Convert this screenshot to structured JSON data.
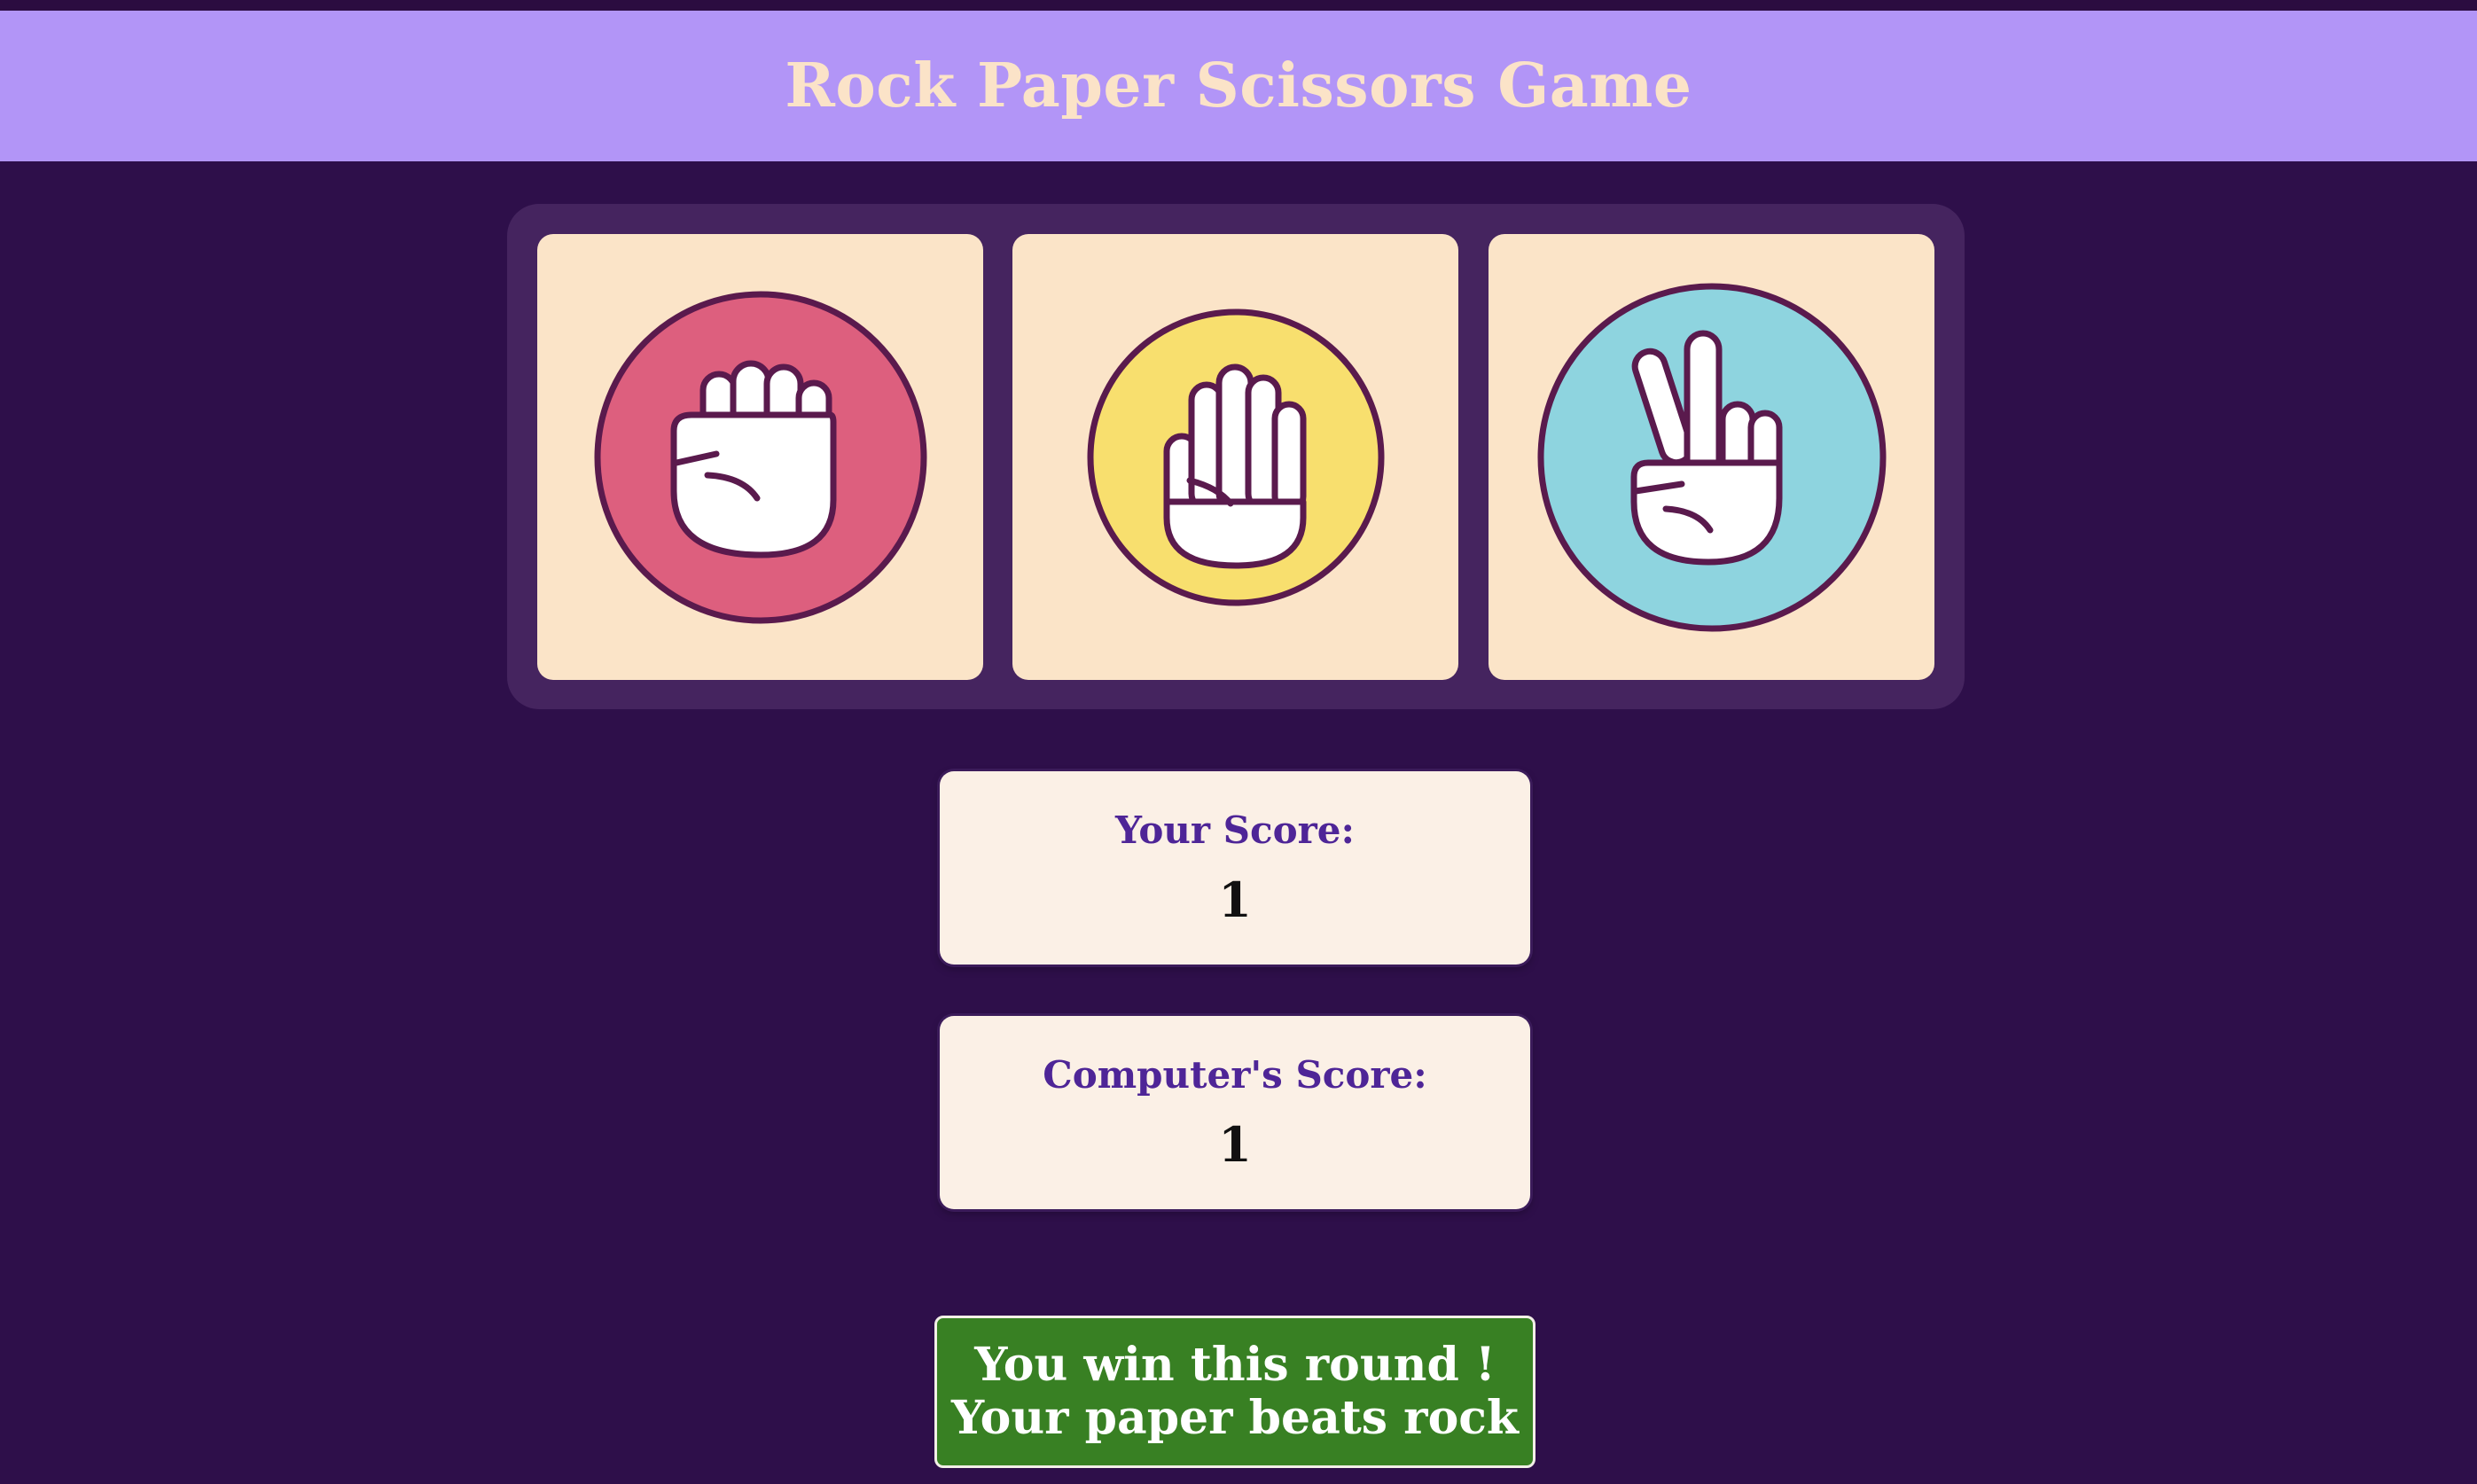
{
  "header": {
    "title": "Rock Paper Scissors Game"
  },
  "choices": [
    {
      "name": "rock",
      "icon": "fist-icon",
      "circle_color": "#dd5f7e"
    },
    {
      "name": "paper",
      "icon": "open-hand-icon",
      "circle_color": "#f8df6e"
    },
    {
      "name": "scissors",
      "icon": "peace-sign-icon",
      "circle_color": "#8ed4df"
    }
  ],
  "scores": {
    "player_label": "Your Score:",
    "player_value": "1",
    "computer_label": "Computer's Score:",
    "computer_value": "1"
  },
  "result": {
    "line1": "You win this round !",
    "line2": "Your paper beats rock"
  },
  "colors": {
    "background": "#2e0f4a",
    "header": "#b295f7",
    "header_text": "#fbe3c8",
    "panel": "#45245f",
    "card": "#fbe4c8",
    "score_label": "#4e2597",
    "result_bg": "#388023",
    "outline": "#5a1a4d"
  }
}
